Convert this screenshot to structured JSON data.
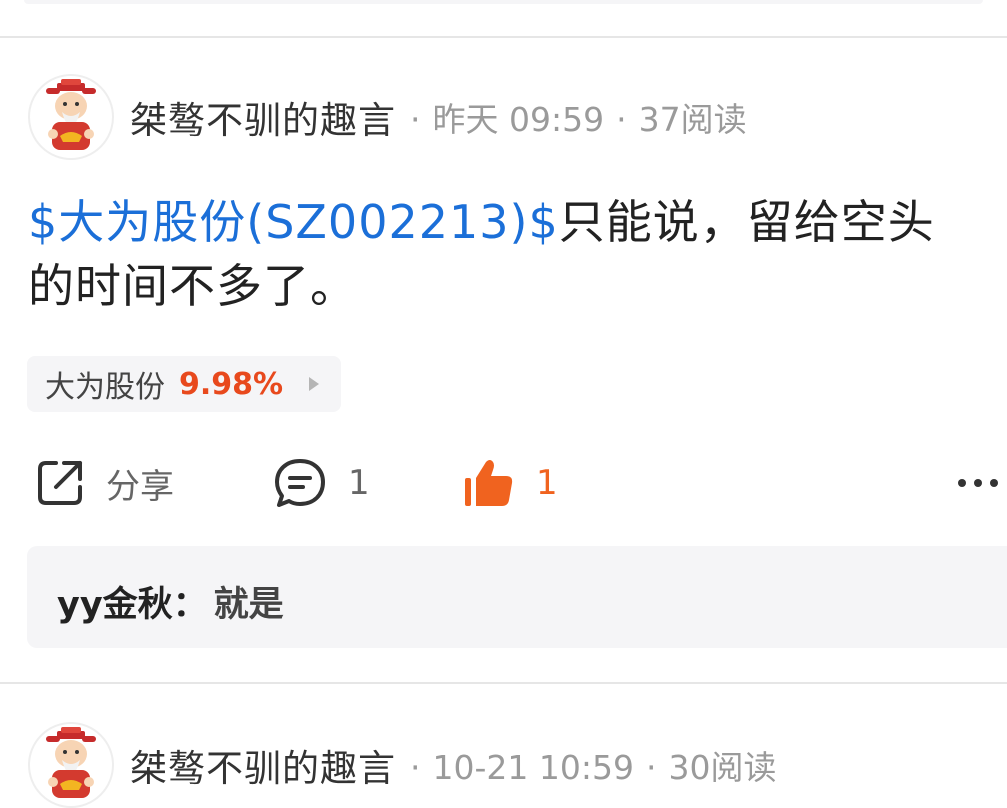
{
  "posts": [
    {
      "author": "桀骜不驯的趣言",
      "time": "昨天 09:59",
      "reads": "37阅读",
      "stock_link": "$大为股份(SZ002213)$",
      "text": "只能说，留给空头的时间不多了。",
      "stock_chip": {
        "name": "大为股份",
        "change": "9.98%"
      },
      "actions": {
        "share_label": "分享",
        "comment_count": "1",
        "like_count": "1"
      },
      "comment": {
        "user": "yy金秋",
        "separator": "：",
        "text": "就是"
      }
    },
    {
      "author": "桀骜不驯的趣言",
      "time": "10-21 10:59",
      "reads": "30阅读"
    }
  ],
  "meta_separator": "·",
  "colors": {
    "link": "#1b6fd8",
    "rise": "#e8491d",
    "like": "#f0631f",
    "muted": "#9a9a9a",
    "chip_bg": "#f5f5f7"
  }
}
